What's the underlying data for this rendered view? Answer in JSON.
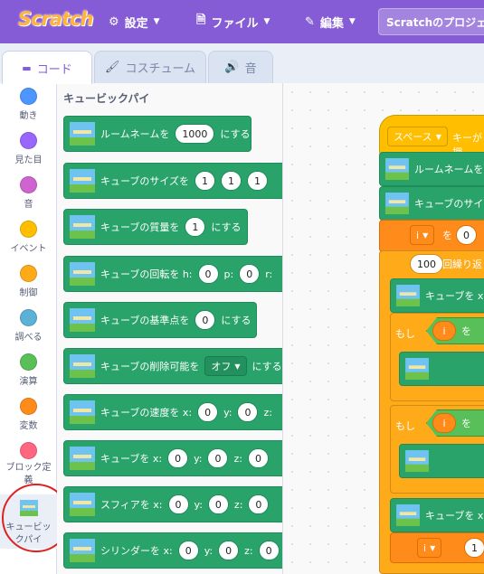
{
  "menubar": {
    "logo": "Scratch",
    "settings": "設定",
    "file": "ファイル",
    "edit": "編集",
    "project_title": "Scratchのプロジェ"
  },
  "tabs": [
    {
      "label": "コード",
      "icon": "code-icon"
    },
    {
      "label": "コスチューム",
      "icon": "brush-icon"
    },
    {
      "label": "音",
      "icon": "speaker-icon"
    }
  ],
  "categories": [
    {
      "label": "動き",
      "color": "#4c97ff"
    },
    {
      "label": "見た目",
      "color": "#9966ff"
    },
    {
      "label": "音",
      "color": "#cf63cf"
    },
    {
      "label": "イベント",
      "color": "#ffbf00"
    },
    {
      "label": "制御",
      "color": "#ffab19"
    },
    {
      "label": "調べる",
      "color": "#5cb1d6"
    },
    {
      "label": "演算",
      "color": "#59c059"
    },
    {
      "label": "変数",
      "color": "#ff8c1a"
    },
    {
      "label": "ブロック定義",
      "color": "#ff6680"
    },
    {
      "label": "キュービックパイ",
      "color": "#29a36a"
    }
  ],
  "palette": {
    "title": "キュービックパイ",
    "blocks": [
      {
        "prefix": "ルームネームを",
        "value": "1000",
        "suffix": "にする"
      },
      {
        "prefix": "キューブのサイズを",
        "v1": "1",
        "v2": "1",
        "v3": "1"
      },
      {
        "prefix": "キューブの質量を",
        "value": "1",
        "suffix": "にする"
      },
      {
        "prefix": "キューブの回転を h:",
        "v1": "0",
        "l2": "p:",
        "v2": "0",
        "l3": "r:"
      },
      {
        "prefix": "キューブの基準点を",
        "value": "0",
        "suffix": "にする"
      },
      {
        "prefix": "キューブの削除可能を",
        "dropdown": "オフ",
        "suffix": "にする"
      },
      {
        "prefix": "キューブの速度を x:",
        "v1": "0",
        "l2": "y:",
        "v2": "0",
        "l3": "z:"
      },
      {
        "prefix": "キューブを x:",
        "v1": "0",
        "l2": "y:",
        "v2": "0",
        "l3": "z:",
        "v3": "0"
      },
      {
        "prefix": "スフィアを x:",
        "v1": "0",
        "l2": "y:",
        "v2": "0",
        "l3": "z:",
        "v3": "0"
      },
      {
        "prefix": "シリンダーを x:",
        "v1": "0",
        "l2": "y:",
        "v2": "0",
        "l3": "z:",
        "v3": "0"
      }
    ]
  },
  "workspace": {
    "event_key": "スペース",
    "event_suffix": "キーが押",
    "block_room": "ルームネームを",
    "block_size": "キューブのサイ",
    "set_var": "i",
    "set_to": "を",
    "set_val": "0",
    "repeat_val": "100",
    "repeat_text": "回繰り返",
    "cube_x": "キューブを x",
    "if1": "もし",
    "if1_var": "i",
    "if1_op": "を",
    "if2": "もし",
    "if2_var": "i",
    "if2_op": "を",
    "cube_x2": "キューブを x",
    "change_var": "i",
    "change_val": "1"
  }
}
